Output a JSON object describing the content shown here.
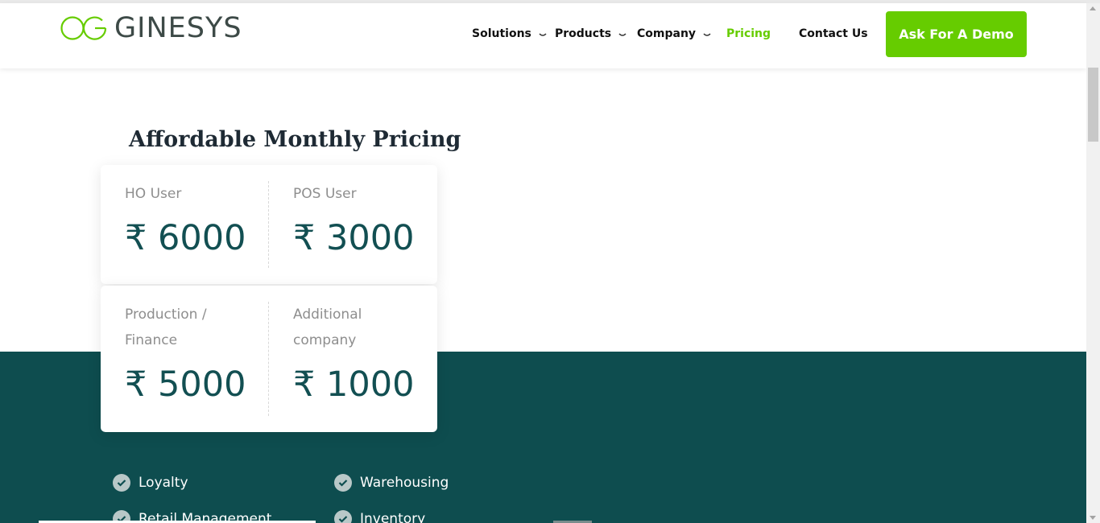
{
  "brand": {
    "name": "GINESYS",
    "logo_icon": "og-circle-logo"
  },
  "nav": {
    "items": [
      {
        "label": "Solutions",
        "has_dropdown": true
      },
      {
        "label": "Products",
        "has_dropdown": true
      },
      {
        "label": "Company",
        "has_dropdown": true
      },
      {
        "label": "Pricing",
        "has_dropdown": false,
        "active": true
      },
      {
        "label": "Contact Us",
        "has_dropdown": false
      }
    ],
    "cta_label": "Ask For A Demo"
  },
  "pricing": {
    "title": "Affordable Monthly Pricing",
    "plans": [
      {
        "label": "HO User",
        "price": "₹ 6000"
      },
      {
        "label": "POS User",
        "price": "₹ 3000"
      },
      {
        "label": "Production /\nFinance",
        "price": "₹ 5000"
      },
      {
        "label": "Additional\ncompany",
        "price": "₹ 1000"
      }
    ]
  },
  "features": [
    "Loyalty",
    "Warehousing",
    "Retail Management",
    "Inventory"
  ],
  "colors": {
    "accent": "#66cc00",
    "teal": "#0e4d4f",
    "price": "#124f52"
  }
}
